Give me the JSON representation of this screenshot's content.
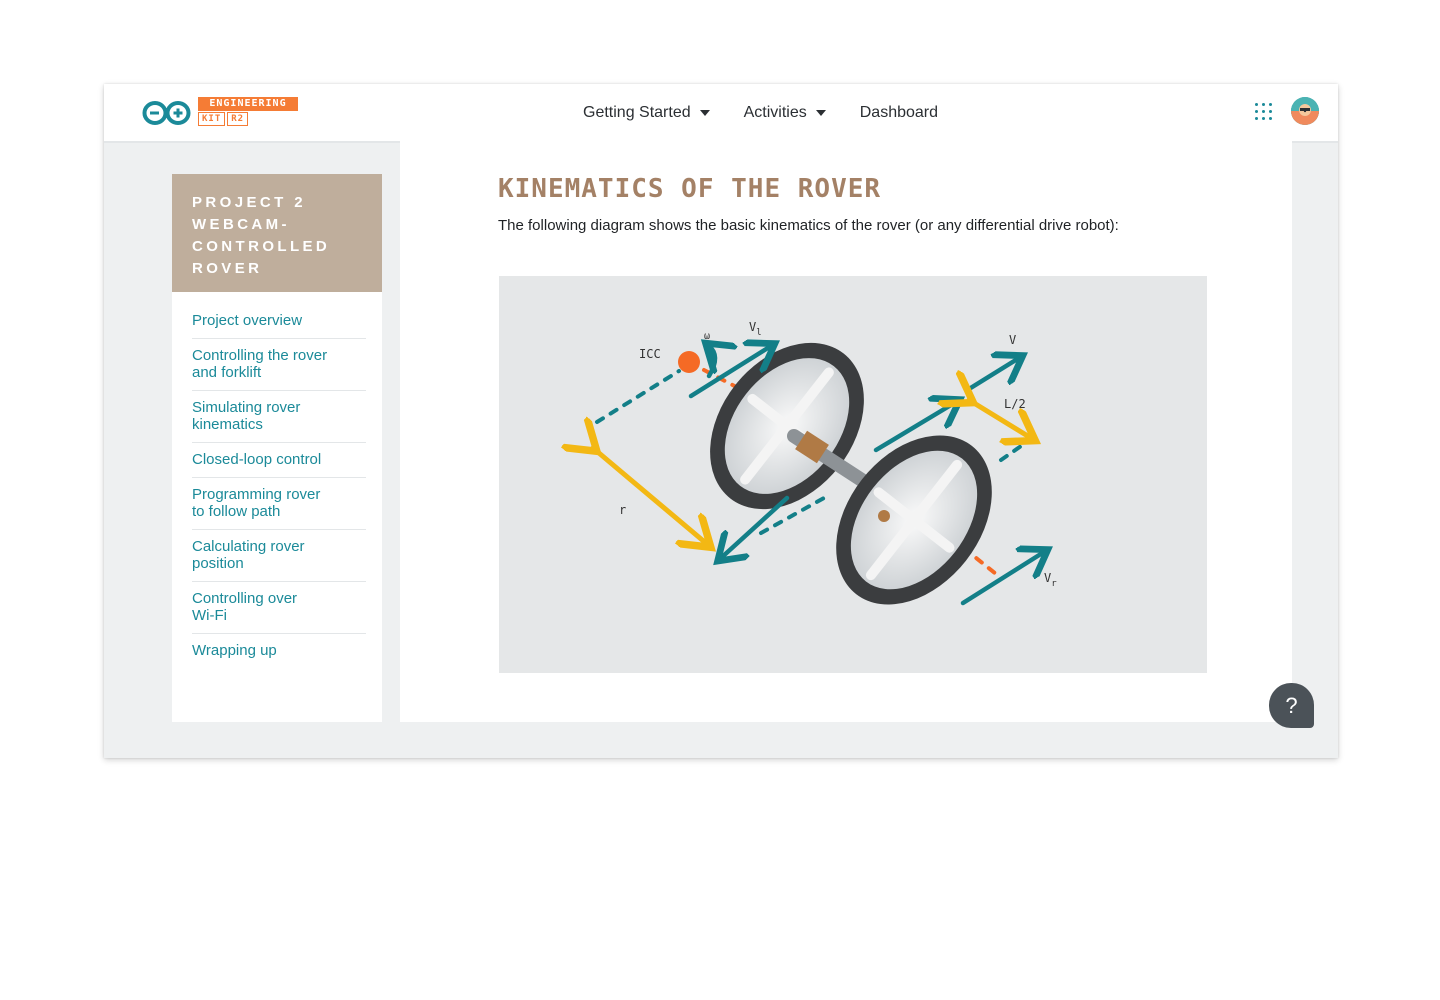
{
  "brand": {
    "badge_top": "ENGINEERING",
    "badge_kit": "KIT",
    "badge_version": "R2"
  },
  "nav": {
    "items": [
      {
        "label": "Getting Started",
        "has_dropdown": true
      },
      {
        "label": "Activities",
        "has_dropdown": true
      },
      {
        "label": "Dashboard",
        "has_dropdown": false
      }
    ]
  },
  "header_icons": {
    "apps": "grid-apps-icon",
    "avatar": "user-avatar"
  },
  "sidebar": {
    "heading_lines": [
      "PROJECT 2",
      "WEBCAM-",
      "CONTROLLED",
      "ROVER"
    ],
    "items": [
      {
        "lines": [
          "Project overview"
        ]
      },
      {
        "lines": [
          "Controlling the rover",
          "and forklift"
        ]
      },
      {
        "lines": [
          "Simulating rover",
          "kinematics"
        ]
      },
      {
        "lines": [
          "Closed-loop control"
        ]
      },
      {
        "lines": [
          "Programming rover",
          "to follow path"
        ]
      },
      {
        "lines": [
          "Calculating rover",
          "position"
        ]
      },
      {
        "lines": [
          "Controlling over",
          "Wi-Fi"
        ]
      },
      {
        "lines": [
          "Wrapping up"
        ]
      }
    ]
  },
  "main": {
    "title": "KINEMATICS OF THE ROVER",
    "description": "The following diagram shows the basic kinematics of the rover (or any differential drive robot):"
  },
  "diagram": {
    "labels": {
      "icc": "ICC",
      "omega": "ω",
      "v_left": "V",
      "v_left_sub": "l",
      "v": "V",
      "half_length": "L/2",
      "radius": "r",
      "v_right": "V",
      "v_right_sub": "r"
    }
  },
  "help": {
    "label": "?"
  },
  "colors": {
    "accent_teal": "#1b8a99",
    "brand_orange": "#f57c35",
    "title_brown": "#a48166",
    "sidebar_header": "#bfae9c",
    "arrow_teal": "#137f88",
    "arrow_yellow": "#f3b814",
    "icc_orange": "#f56a25"
  }
}
